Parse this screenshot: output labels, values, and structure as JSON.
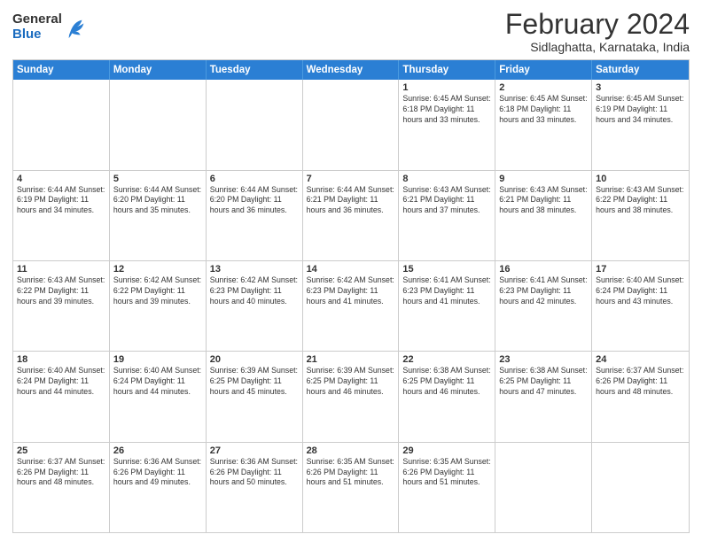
{
  "header": {
    "logo": {
      "general": "General",
      "blue": "Blue"
    },
    "title": "February 2024",
    "subtitle": "Sidlaghatta, Karnataka, India"
  },
  "days": [
    "Sunday",
    "Monday",
    "Tuesday",
    "Wednesday",
    "Thursday",
    "Friday",
    "Saturday"
  ],
  "weeks": [
    [
      {
        "date": "",
        "info": ""
      },
      {
        "date": "",
        "info": ""
      },
      {
        "date": "",
        "info": ""
      },
      {
        "date": "",
        "info": ""
      },
      {
        "date": "1",
        "info": "Sunrise: 6:45 AM\nSunset: 6:18 PM\nDaylight: 11 hours\nand 33 minutes."
      },
      {
        "date": "2",
        "info": "Sunrise: 6:45 AM\nSunset: 6:18 PM\nDaylight: 11 hours\nand 33 minutes."
      },
      {
        "date": "3",
        "info": "Sunrise: 6:45 AM\nSunset: 6:19 PM\nDaylight: 11 hours\nand 34 minutes."
      }
    ],
    [
      {
        "date": "4",
        "info": "Sunrise: 6:44 AM\nSunset: 6:19 PM\nDaylight: 11 hours\nand 34 minutes."
      },
      {
        "date": "5",
        "info": "Sunrise: 6:44 AM\nSunset: 6:20 PM\nDaylight: 11 hours\nand 35 minutes."
      },
      {
        "date": "6",
        "info": "Sunrise: 6:44 AM\nSunset: 6:20 PM\nDaylight: 11 hours\nand 36 minutes."
      },
      {
        "date": "7",
        "info": "Sunrise: 6:44 AM\nSunset: 6:21 PM\nDaylight: 11 hours\nand 36 minutes."
      },
      {
        "date": "8",
        "info": "Sunrise: 6:43 AM\nSunset: 6:21 PM\nDaylight: 11 hours\nand 37 minutes."
      },
      {
        "date": "9",
        "info": "Sunrise: 6:43 AM\nSunset: 6:21 PM\nDaylight: 11 hours\nand 38 minutes."
      },
      {
        "date": "10",
        "info": "Sunrise: 6:43 AM\nSunset: 6:22 PM\nDaylight: 11 hours\nand 38 minutes."
      }
    ],
    [
      {
        "date": "11",
        "info": "Sunrise: 6:43 AM\nSunset: 6:22 PM\nDaylight: 11 hours\nand 39 minutes."
      },
      {
        "date": "12",
        "info": "Sunrise: 6:42 AM\nSunset: 6:22 PM\nDaylight: 11 hours\nand 39 minutes."
      },
      {
        "date": "13",
        "info": "Sunrise: 6:42 AM\nSunset: 6:23 PM\nDaylight: 11 hours\nand 40 minutes."
      },
      {
        "date": "14",
        "info": "Sunrise: 6:42 AM\nSunset: 6:23 PM\nDaylight: 11 hours\nand 41 minutes."
      },
      {
        "date": "15",
        "info": "Sunrise: 6:41 AM\nSunset: 6:23 PM\nDaylight: 11 hours\nand 41 minutes."
      },
      {
        "date": "16",
        "info": "Sunrise: 6:41 AM\nSunset: 6:23 PM\nDaylight: 11 hours\nand 42 minutes."
      },
      {
        "date": "17",
        "info": "Sunrise: 6:40 AM\nSunset: 6:24 PM\nDaylight: 11 hours\nand 43 minutes."
      }
    ],
    [
      {
        "date": "18",
        "info": "Sunrise: 6:40 AM\nSunset: 6:24 PM\nDaylight: 11 hours\nand 44 minutes."
      },
      {
        "date": "19",
        "info": "Sunrise: 6:40 AM\nSunset: 6:24 PM\nDaylight: 11 hours\nand 44 minutes."
      },
      {
        "date": "20",
        "info": "Sunrise: 6:39 AM\nSunset: 6:25 PM\nDaylight: 11 hours\nand 45 minutes."
      },
      {
        "date": "21",
        "info": "Sunrise: 6:39 AM\nSunset: 6:25 PM\nDaylight: 11 hours\nand 46 minutes."
      },
      {
        "date": "22",
        "info": "Sunrise: 6:38 AM\nSunset: 6:25 PM\nDaylight: 11 hours\nand 46 minutes."
      },
      {
        "date": "23",
        "info": "Sunrise: 6:38 AM\nSunset: 6:25 PM\nDaylight: 11 hours\nand 47 minutes."
      },
      {
        "date": "24",
        "info": "Sunrise: 6:37 AM\nSunset: 6:26 PM\nDaylight: 11 hours\nand 48 minutes."
      }
    ],
    [
      {
        "date": "25",
        "info": "Sunrise: 6:37 AM\nSunset: 6:26 PM\nDaylight: 11 hours\nand 48 minutes."
      },
      {
        "date": "26",
        "info": "Sunrise: 6:36 AM\nSunset: 6:26 PM\nDaylight: 11 hours\nand 49 minutes."
      },
      {
        "date": "27",
        "info": "Sunrise: 6:36 AM\nSunset: 6:26 PM\nDaylight: 11 hours\nand 50 minutes."
      },
      {
        "date": "28",
        "info": "Sunrise: 6:35 AM\nSunset: 6:26 PM\nDaylight: 11 hours\nand 51 minutes."
      },
      {
        "date": "29",
        "info": "Sunrise: 6:35 AM\nSunset: 6:26 PM\nDaylight: 11 hours\nand 51 minutes."
      },
      {
        "date": "",
        "info": ""
      },
      {
        "date": "",
        "info": ""
      }
    ]
  ]
}
